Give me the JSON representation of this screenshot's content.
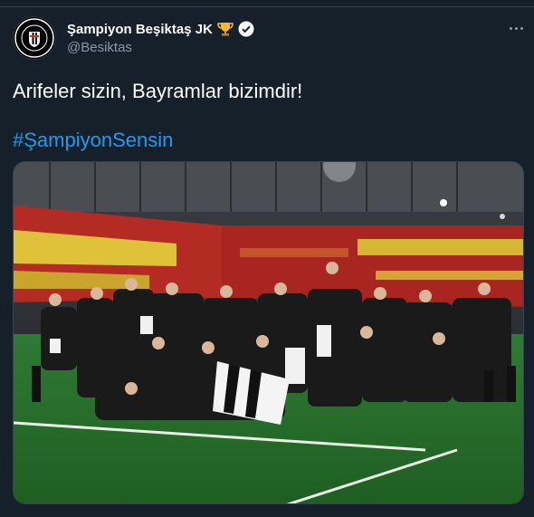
{
  "tweet": {
    "display_name": "Şampiyon Beşiktaş JK",
    "handle": "@Besiktas",
    "text": "Arifeler sizin, Bayramlar bizimdir!",
    "hashtag": "#ŞampiyonSensin",
    "icons": [
      "trophy-icon",
      "verified-badge-icon",
      "more-options-icon"
    ],
    "media": "team celebration photo on stadium pitch"
  },
  "colors": {
    "background": "#15202b",
    "primary_text": "#ffffff",
    "secondary_text": "#8b98a5",
    "link": "#1d9bf0"
  }
}
